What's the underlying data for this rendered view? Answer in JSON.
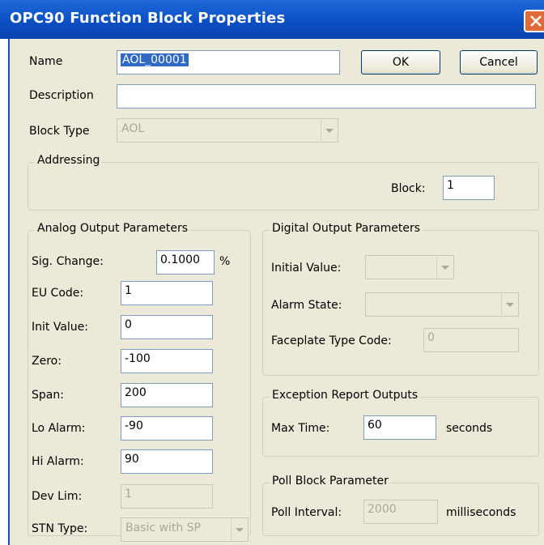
{
  "window": {
    "title": "OPC90 Function Block Properties"
  },
  "name": {
    "label": "Name",
    "value": "AOL_00001"
  },
  "buttons": {
    "ok": "OK",
    "cancel": "Cancel"
  },
  "description": {
    "label": "Description",
    "value": ""
  },
  "block_type": {
    "label": "Block Type",
    "value": "AOL"
  },
  "addressing": {
    "title": "Addressing",
    "block_label": "Block:",
    "block_value": "1"
  },
  "analog": {
    "title": "Analog Output Parameters",
    "sig_change_label": "Sig. Change:",
    "sig_change_value": "0.1000",
    "sig_change_unit": "%",
    "eu_code_label": "EU Code:",
    "eu_code_value": "1",
    "init_value_label": "Init Value:",
    "init_value_value": "0",
    "zero_label": "Zero:",
    "zero_value": "-100",
    "span_label": "Span:",
    "span_value": "200",
    "lo_alarm_label": "Lo Alarm:",
    "lo_alarm_value": "-90",
    "hi_alarm_label": "Hi Alarm:",
    "hi_alarm_value": "90",
    "dev_lim_label": "Dev Lim:",
    "dev_lim_value": "1",
    "stn_type_label": "STN Type:",
    "stn_type_value": "Basic with SP"
  },
  "digital": {
    "title": "Digital Output Parameters",
    "initial_value_label": "Initial Value:",
    "initial_value_value": "",
    "alarm_state_label": "Alarm State:",
    "alarm_state_value": "",
    "faceplate_label": "Faceplate Type Code:",
    "faceplate_value": "0"
  },
  "exception": {
    "title": "Exception Report Outputs",
    "max_time_label": "Max Time:",
    "max_time_value": "60",
    "max_time_unit": "seconds"
  },
  "poll": {
    "title": "Poll Block Parameter",
    "interval_label": "Poll Interval:",
    "interval_value": "2000",
    "interval_unit": "milliseconds"
  },
  "colors": {
    "titlebar": "#0b4fc4",
    "dialog_bg": "#ece9d8",
    "selection": "#316ac5",
    "close_button": "#e06a3a"
  },
  "icons": {
    "close": "close-x-icon",
    "dropdown": "dropdown-arrow-icon"
  }
}
